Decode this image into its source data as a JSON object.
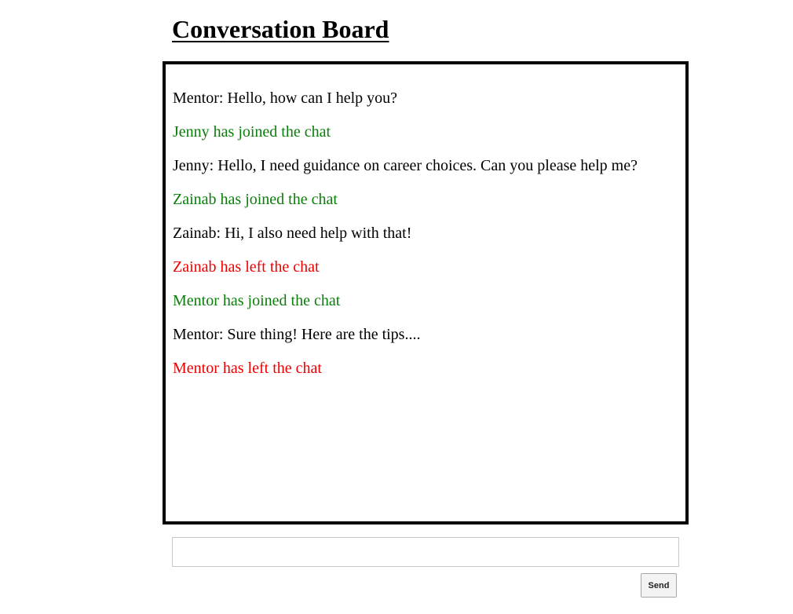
{
  "page": {
    "title": "Conversation Board"
  },
  "colors": {
    "join": "#0a7d0a",
    "leave": "#ee0000",
    "text": "#000000"
  },
  "chat": {
    "messages": [
      {
        "type": "text",
        "text": "Mentor: Hello, how can I help you?"
      },
      {
        "type": "join",
        "text": "Jenny has joined the chat"
      },
      {
        "type": "text",
        "text": "Jenny: Hello, I need guidance on career choices. Can you please help me?"
      },
      {
        "type": "join",
        "text": "Zainab has joined the chat"
      },
      {
        "type": "text",
        "text": "Zainab: Hi, I also need help with that!"
      },
      {
        "type": "leave",
        "text": "Zainab has left the chat"
      },
      {
        "type": "join",
        "text": "Mentor has joined the chat"
      },
      {
        "type": "text",
        "text": "Mentor: Sure thing! Here are the tips...."
      },
      {
        "type": "leave",
        "text": "Mentor has left the chat"
      }
    ]
  },
  "composer": {
    "input_value": "",
    "input_placeholder": "",
    "send_label": "Send"
  }
}
